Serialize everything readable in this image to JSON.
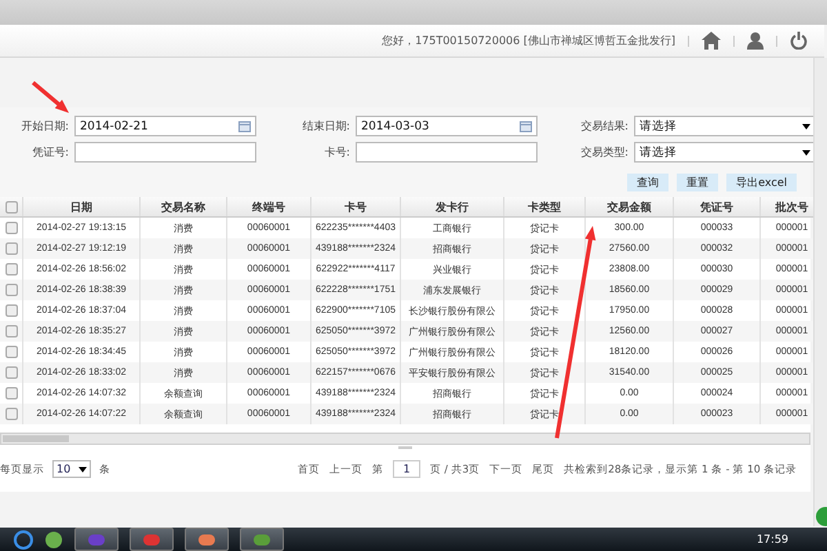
{
  "header": {
    "greeting": "您好，175T00150720006 [佛山市禅城区博哲五金批发行]"
  },
  "form": {
    "fields": [
      {
        "label": "开始日期:",
        "kind": "date",
        "value": "2014-02-21"
      },
      {
        "label": "结束日期:",
        "kind": "date",
        "value": "2014-03-03"
      },
      {
        "label": "交易结果:",
        "kind": "select",
        "value": "请选择"
      },
      {
        "label": "凭证号:",
        "kind": "text"
      },
      {
        "label": "卡号:",
        "kind": "text"
      },
      {
        "label": "交易类型:",
        "kind": "select",
        "value": "请选择"
      }
    ],
    "buttons": [
      "查询",
      "重置",
      "导出excel"
    ]
  },
  "table": {
    "header_checked": false,
    "columns": [
      "日期",
      "交易名称",
      "终端号",
      "卡号",
      "发卡行",
      "卡类型",
      "交易金额",
      "凭证号",
      "批次号"
    ],
    "rows": [
      {
        "checked": false,
        "cells": [
          "2014-02-27 19:13:15",
          "消费",
          "00060001",
          "622235*******4403",
          "工商银行",
          "贷记卡",
          "300.00",
          "000033",
          "000001"
        ]
      },
      {
        "checked": false,
        "cells": [
          "2014-02-27 19:12:19",
          "消费",
          "00060001",
          "439188*******2324",
          "招商银行",
          "贷记卡",
          "27560.00",
          "000032",
          "000001"
        ]
      },
      {
        "checked": false,
        "cells": [
          "2014-02-26 18:56:02",
          "消费",
          "00060001",
          "622922*******4117",
          "兴业银行",
          "贷记卡",
          "23808.00",
          "000030",
          "000001"
        ]
      },
      {
        "checked": false,
        "cells": [
          "2014-02-26 18:38:39",
          "消费",
          "00060001",
          "622228*******1751",
          "浦东发展银行",
          "贷记卡",
          "18560.00",
          "000029",
          "000001"
        ]
      },
      {
        "checked": false,
        "cells": [
          "2014-02-26 18:37:04",
          "消费",
          "00060001",
          "622900*******7105",
          "长沙银行股份有限公",
          "贷记卡",
          "17950.00",
          "000028",
          "000001"
        ]
      },
      {
        "checked": false,
        "cells": [
          "2014-02-26 18:35:27",
          "消费",
          "00060001",
          "625050*******3972",
          "广州银行股份有限公",
          "贷记卡",
          "12560.00",
          "000027",
          "000001"
        ]
      },
      {
        "checked": false,
        "cells": [
          "2014-02-26 18:34:45",
          "消费",
          "00060001",
          "625050*******3972",
          "广州银行股份有限公",
          "贷记卡",
          "18120.00",
          "000026",
          "000001"
        ]
      },
      {
        "checked": false,
        "cells": [
          "2014-02-26 18:33:02",
          "消费",
          "00060001",
          "622157*******0676",
          "平安银行股份有限公",
          "贷记卡",
          "31540.00",
          "000025",
          "000001"
        ]
      },
      {
        "checked": false,
        "cells": [
          "2014-02-26 14:07:32",
          "余额查询",
          "00060001",
          "439188*******2324",
          "招商银行",
          "贷记卡",
          "0.00",
          "000024",
          "000001"
        ]
      },
      {
        "checked": false,
        "cells": [
          "2014-02-26 14:07:22",
          "余额查询",
          "00060001",
          "439188*******2324",
          "招商银行",
          "贷记卡",
          "0.00",
          "000023",
          "000001"
        ]
      }
    ]
  },
  "pager": {
    "per_page_label": "每页显示",
    "per_page": "10",
    "per_page_unit": "条",
    "first": "首页",
    "prev": "上一页",
    "page_prefix": "第",
    "page": "1",
    "page_suffix": "页 / 共3页",
    "next": "下一页",
    "last": "尾页",
    "summary": "共检索到28条记录，显示第 1 条 - 第 10 条记录"
  },
  "taskbar": {
    "clock": "17:59"
  }
}
